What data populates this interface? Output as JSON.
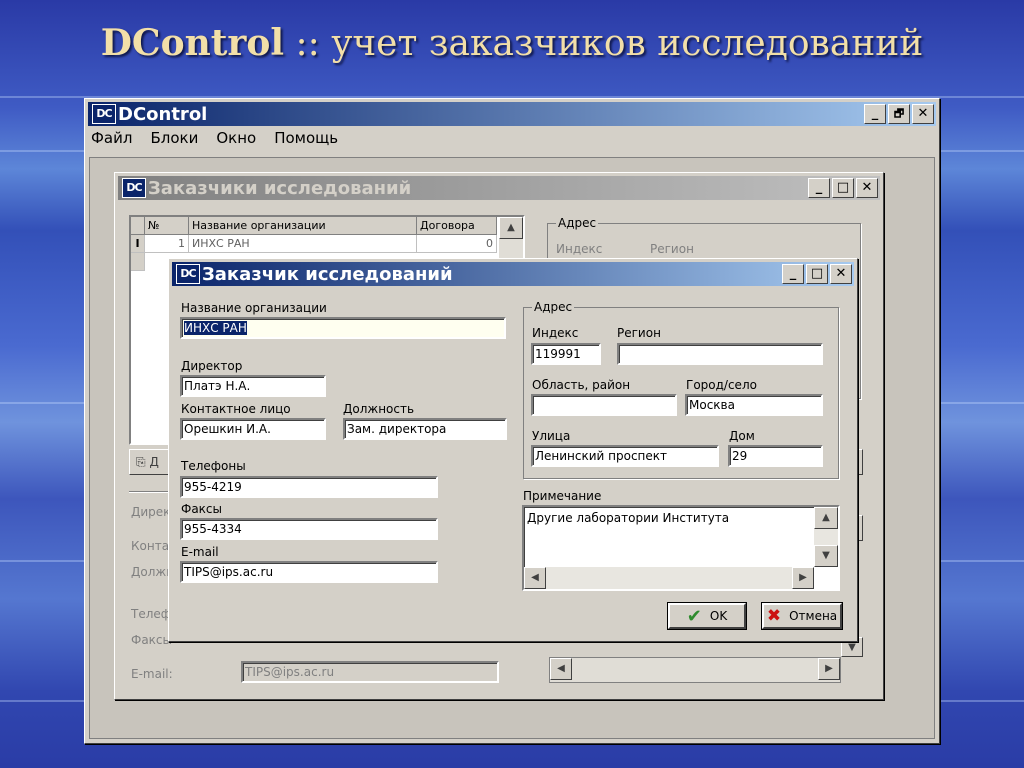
{
  "slide": {
    "title_brand": "DControl",
    "title_sep": " :: ",
    "title_text": "учет заказчиков исследований"
  },
  "main_window": {
    "logo": "DC",
    "title": "DControl",
    "menu": [
      "Файл",
      "Блоки",
      "Окно",
      "Помощь"
    ],
    "controls": {
      "minimize": "_",
      "restore": "🗗",
      "close": "✕"
    }
  },
  "customers_window": {
    "logo": "DC",
    "title": "Заказчики исследований",
    "grid": {
      "columns": [
        "№",
        "Название организации",
        "Договора"
      ],
      "rows": [
        {
          "num": "1",
          "name": "ИНХС РАН",
          "contracts": "0"
        }
      ],
      "row_indicator": "I"
    },
    "address_group": "Адрес",
    "address_labels": {
      "index": "Индекс",
      "region": "Регион"
    },
    "side_labels": {
      "director": "Директ",
      "contact": "Контак",
      "position": "Должн",
      "phones": "Телеф",
      "faxes": "Факсы",
      "email": "E-mail:"
    },
    "add_button": "Д",
    "email_value": "TIPS@ips.ac.ru",
    "faxes_value": "955-4334"
  },
  "customer_dialog": {
    "logo": "DC",
    "title": "Заказчик исследований",
    "labels": {
      "org_name": "Название организации",
      "director": "Директор",
      "contact": "Контактное лицо",
      "position": "Должность",
      "phones": "Телефоны",
      "faxes": "Факсы",
      "email": "E-mail",
      "address": "Адрес",
      "index": "Индекс",
      "region": "Регион",
      "district": "Область, район",
      "city": "Город/село",
      "street": "Улица",
      "house": "Дом",
      "note": "Примечание"
    },
    "values": {
      "org_name": "ИНХС РАН",
      "director": "Платэ Н.А.",
      "contact": "Орешкин И.А.",
      "position": "Зам. директора",
      "phones": "955-4219",
      "faxes": "955-4334",
      "email": "TIPS@ips.ac.ru",
      "index": "119991",
      "region": "",
      "district": "",
      "city": "Москва",
      "street": "Ленинский проспект",
      "house": "29",
      "note": "Другие лаборатории Института"
    },
    "ok_label": "OK",
    "cancel_label": "Отмена",
    "colors": {
      "ok_check": "#2e8b2e",
      "cancel_x": "#cc1111"
    }
  }
}
